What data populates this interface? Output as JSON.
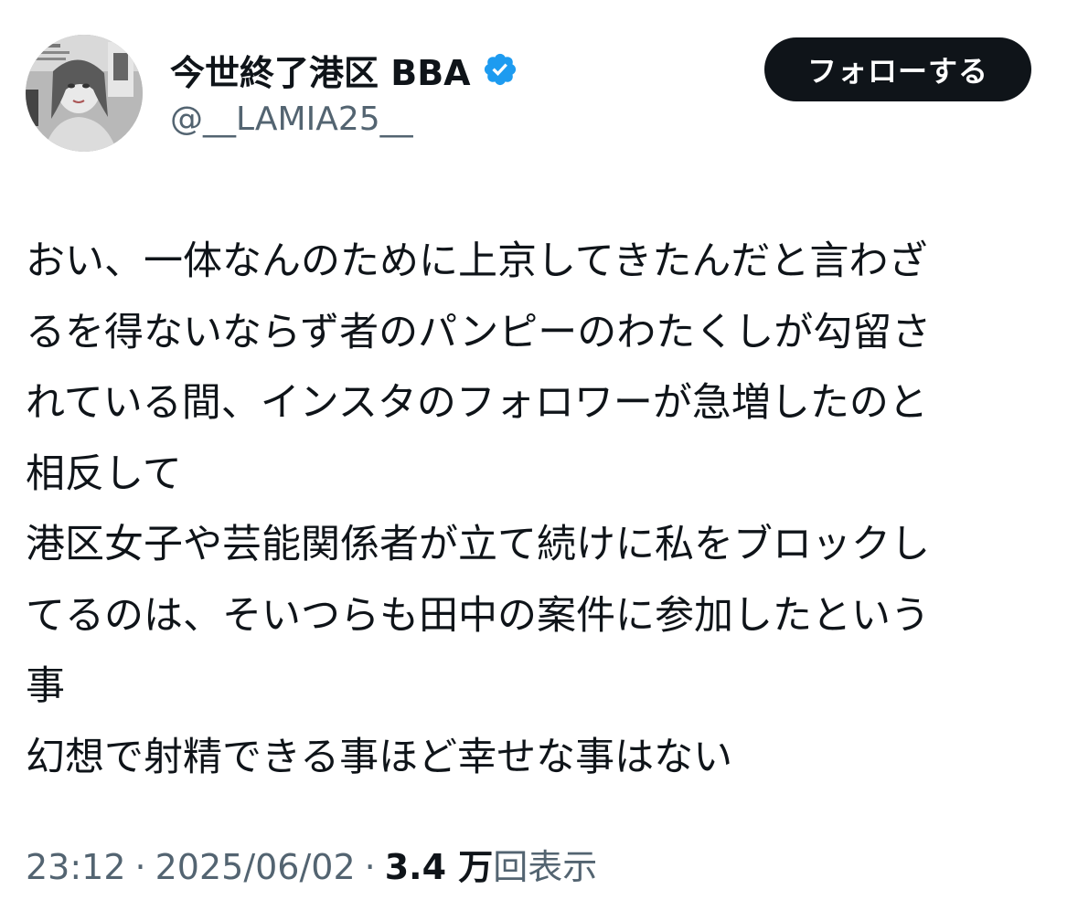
{
  "author": {
    "display_name": "今世終了港区 BBA",
    "handle": "@__LAMIA25__",
    "verified_icon": "verified-badge-icon",
    "verified_color": "#1d9bf0"
  },
  "follow_button": {
    "label": "フォローする"
  },
  "tweet": {
    "lines": [
      "おい、一体なんのために上京してきたんだと言わざ",
      "るを得ないならず者のパンピーのわたくしが勾留さ",
      "れている間、インスタのフォロワーが急増したのと",
      "相反して",
      "港区女子や芸能関係者が立て続けに私をブロックし",
      "てるのは、そいつらも田中の案件に参加したという",
      "事",
      "幻想で射精できる事ほど幸せな事はない"
    ]
  },
  "meta": {
    "time": "23:12",
    "separator": "·",
    "date": "2025/06/02",
    "views_count": "3.4 万",
    "views_label": "回表示"
  },
  "colors": {
    "text": "#0f1419",
    "secondary": "#536471",
    "button_bg": "#0f1419",
    "button_text": "#ffffff"
  }
}
